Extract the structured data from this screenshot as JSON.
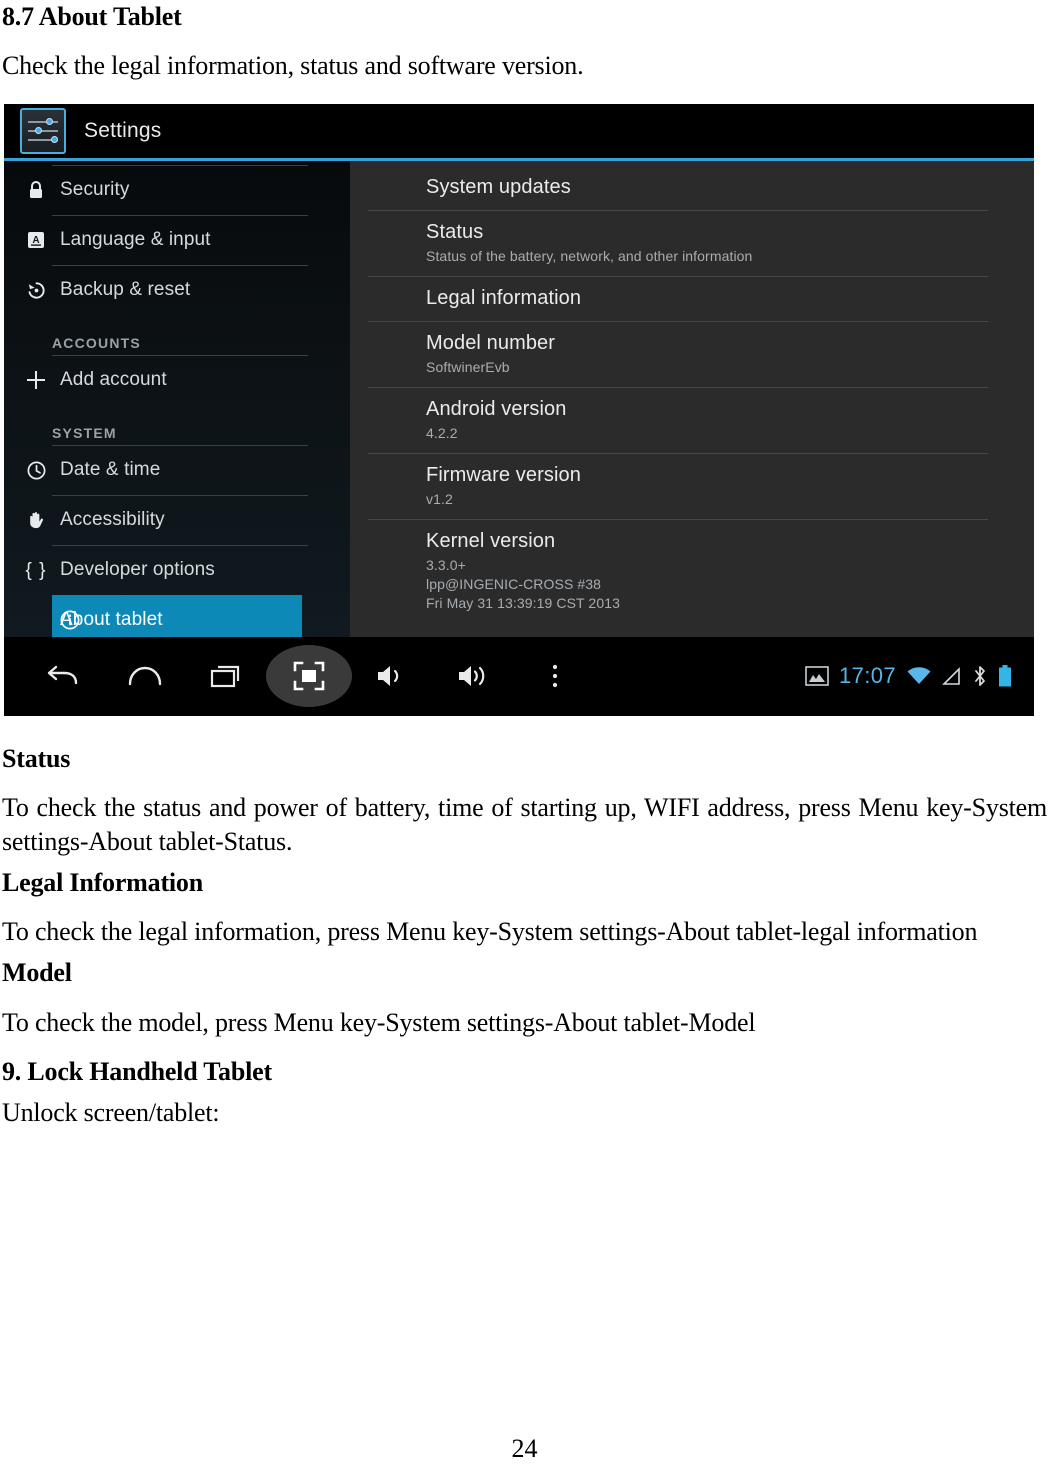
{
  "document": {
    "heading": "8.7 About Tablet",
    "intro": "Check the legal information, status and software version.",
    "sections": [
      {
        "heading": "Status",
        "body": "To check the status and power of battery, time of starting up, WIFI address, press Menu key-System settings-About tablet-Status."
      },
      {
        "heading": "Legal Information",
        "body": "To check the legal information, press Menu key-System settings-About tablet-legal information"
      },
      {
        "heading": "Model",
        "body": "To check the model, press Menu key-System settings-About tablet-Model"
      },
      {
        "heading": "9. Lock Handheld Tablet",
        "body": "Unlock screen/tablet:"
      }
    ],
    "page_number": "24"
  },
  "screenshot": {
    "header": {
      "app_title": "Settings",
      "app_icon": "settings-sliders-icon",
      "accent_color": "#3aa0d8"
    },
    "sidebar": {
      "items": [
        {
          "label": "Security",
          "icon": "lock-icon",
          "type": "item",
          "selected": false
        },
        {
          "label": "Language & input",
          "icon": "keyboard-letter-a-icon",
          "type": "item",
          "selected": false
        },
        {
          "label": "Backup & reset",
          "icon": "backup-restore-icon",
          "type": "item",
          "selected": false
        },
        {
          "label": "ACCOUNTS",
          "icon": "",
          "type": "header",
          "selected": false
        },
        {
          "label": "Add account",
          "icon": "plus-icon",
          "type": "item",
          "selected": false
        },
        {
          "label": "SYSTEM",
          "icon": "",
          "type": "header",
          "selected": false
        },
        {
          "label": "Date & time",
          "icon": "clock-icon",
          "type": "item",
          "selected": false
        },
        {
          "label": "Accessibility",
          "icon": "hand-icon",
          "type": "item",
          "selected": false
        },
        {
          "label": "Developer options",
          "icon": "curly-braces-icon",
          "type": "item",
          "selected": false
        },
        {
          "label": "About tablet",
          "icon": "info-circle-icon",
          "type": "item",
          "selected": true
        }
      ],
      "selected_color": "#0d89b8"
    },
    "content": {
      "rows": [
        {
          "title": "System updates",
          "subtitle": ""
        },
        {
          "title": "Status",
          "subtitle": "Status of the battery, network, and other information"
        },
        {
          "title": "Legal information",
          "subtitle": ""
        },
        {
          "title": "Model number",
          "subtitle": "SoftwinerEvb"
        },
        {
          "title": "Android version",
          "subtitle": "4.2.2"
        },
        {
          "title": "Firmware version",
          "subtitle": "v1.2"
        },
        {
          "title": "Kernel version",
          "subtitle": "3.3.0+\nlpp@INGENIC-CROSS #38\nFri May 31 13:39:19 CST 2013"
        }
      ]
    },
    "navbar": {
      "buttons": [
        {
          "name": "back-icon"
        },
        {
          "name": "home-icon"
        },
        {
          "name": "recent-apps-icon"
        },
        {
          "name": "screenshot-icon"
        },
        {
          "name": "volume-down-icon"
        },
        {
          "name": "volume-up-icon"
        },
        {
          "name": "overflow-menu-icon"
        }
      ],
      "status": {
        "screenshot_notification": "image-icon",
        "clock": "17:07",
        "clock_color": "#57b4e8",
        "wifi": "wifi-icon",
        "signal": "signal-icon",
        "bluetooth": "bluetooth-icon",
        "battery": "battery-icon"
      }
    }
  }
}
